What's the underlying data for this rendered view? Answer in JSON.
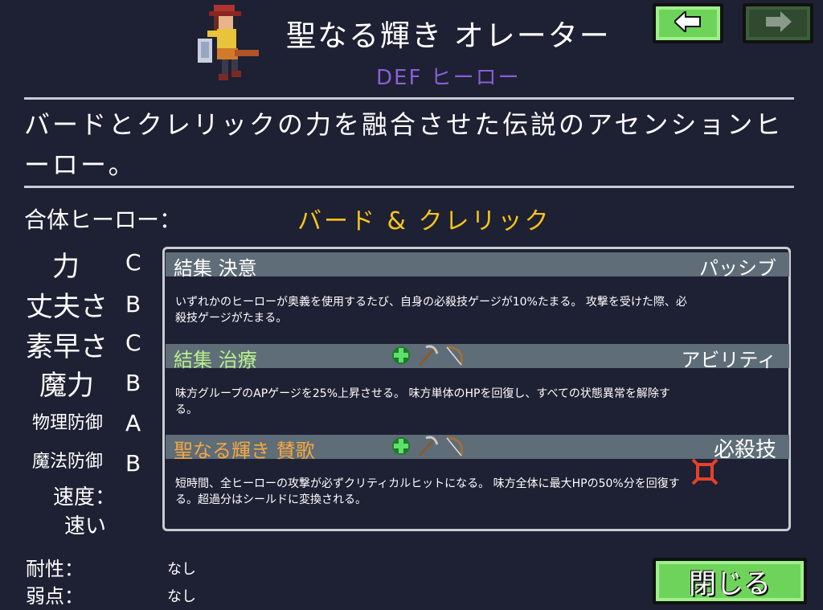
{
  "header": {
    "title": "聖なる輝き オレーター",
    "subtitle": "DEF ヒーロー"
  },
  "description": "バードとクレリックの力を融合させた伝説のアセンションヒーロー。",
  "fusion": {
    "label": "合体ヒーロー：",
    "value": "バード & クレリック"
  },
  "stats": [
    {
      "name": "力",
      "grade": "C"
    },
    {
      "name": "丈夫さ",
      "grade": "B"
    },
    {
      "name": "素早さ",
      "grade": "C"
    },
    {
      "name": "魔力",
      "grade": "B"
    },
    {
      "name": "物理防御",
      "grade": "A"
    },
    {
      "name": "魔法防御",
      "grade": "B"
    }
  ],
  "speed": {
    "label": "速度：",
    "value": "速い"
  },
  "resistance": {
    "label": "耐性：",
    "value": "なし"
  },
  "weakness": {
    "label": "弱点：",
    "value": "なし"
  },
  "skills": [
    {
      "name": "結集 決意",
      "type": "パッシブ",
      "text": "いずれかのヒーローが奥義を使用するたび、自身の必殺技ゲージが10%たまる。 攻撃を受けた際、必殺技ゲージがたまる。"
    },
    {
      "name": "結集 治療",
      "type": "アビリティ",
      "icons": [
        "green-cross-icon",
        "pickaxe-icon",
        "bow-icon"
      ],
      "text": "味方グループのAPゲージを25%上昇させる。 味方単体のHPを回復し、すべての状態異常を解除する。"
    },
    {
      "name": "聖なる輝き 賛歌",
      "type": "必殺技",
      "icons": [
        "green-cross-icon",
        "pickaxe-icon",
        "bow-icon",
        "ultimate-burst-icon"
      ],
      "text": "短時間、全ヒーローの攻撃が必ずクリティカルヒットになる。 味方全体に最大HPの50%分を回復する。超過分はシールドに変換される。"
    }
  ],
  "buttons": {
    "close_label": "閉じる"
  },
  "colors": {
    "background": "#1e2033",
    "accent_gold": "#f5c518",
    "subtitle_purple": "#8a5fd6",
    "skill_bar": "#5e6d78",
    "button_green": "#6ed35a"
  }
}
